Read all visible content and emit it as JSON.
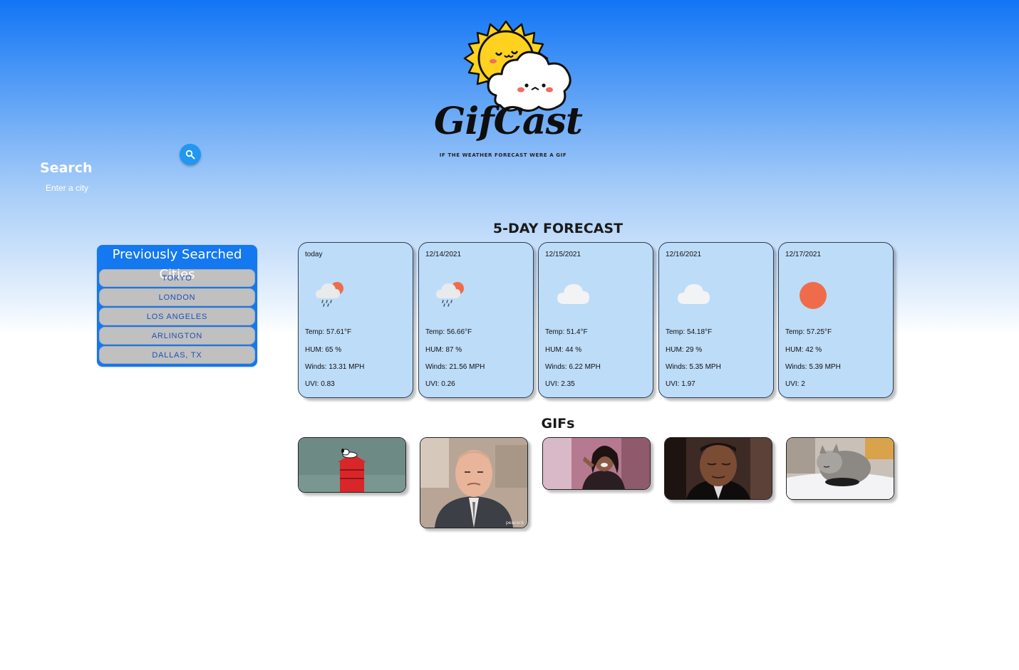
{
  "logo": {
    "name": "GifCast",
    "tagline": "IF THE WEATHER FORECAST WERE A GIF"
  },
  "search": {
    "title": "Search",
    "placeholder": "Enter a city",
    "button_icon": "search-icon"
  },
  "history": {
    "title": "Previously Searched Cities",
    "cities": [
      "TOKYO",
      "LONDON",
      "LOS ANGELES",
      "ARLINGTON",
      "DALLAS, TX"
    ]
  },
  "forecast": {
    "title": "5-DAY FORECAST",
    "days": [
      {
        "date": "today",
        "icon": "rain-sun-icon",
        "temp": "Temp: 57.61°F",
        "hum": "HUM: 65 %",
        "wind": "Winds: 13.31 MPH",
        "uvi": "UVI: 0.83"
      },
      {
        "date": "12/14/2021",
        "icon": "rain-sun-icon",
        "temp": "Temp: 56.66°F",
        "hum": "HUM: 87 %",
        "wind": "Winds: 21.56 MPH",
        "uvi": "UVI: 0.26"
      },
      {
        "date": "12/15/2021",
        "icon": "cloud-icon",
        "temp": "Temp: 51.4°F",
        "hum": "HUM: 44 %",
        "wind": "Winds: 6.22 MPH",
        "uvi": "UVI: 2.35"
      },
      {
        "date": "12/16/2021",
        "icon": "cloud-icon",
        "temp": "Temp: 54.18°F",
        "hum": "HUM: 29 %",
        "wind": "Winds: 5.35 MPH",
        "uvi": "UVI: 1.97"
      },
      {
        "date": "12/17/2021",
        "icon": "sun-icon",
        "temp": "Temp: 57.25°F",
        "hum": "HUM: 42 %",
        "wind": "Winds: 5.39 MPH",
        "uvi": "UVI: 2"
      }
    ]
  },
  "gifs": {
    "title": "GIFs",
    "items": [
      "snoopy-doghouse-gif",
      "office-man-gif",
      "woman-laughing-gif",
      "man-eyes-closed-gif",
      "cat-brush-gif"
    ]
  },
  "colors": {
    "accent": "#1478f0",
    "search_button": "#2196f3",
    "card_bg": "#bddcf8",
    "city_text": "#1a50b8"
  }
}
